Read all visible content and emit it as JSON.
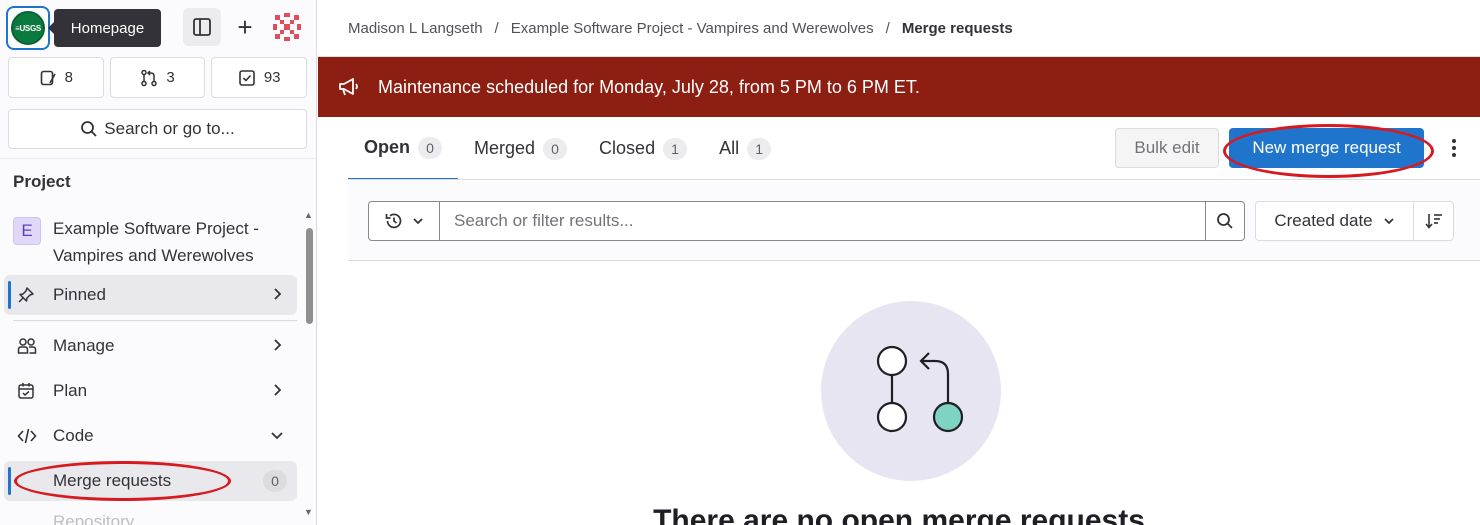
{
  "sidebar": {
    "logo_text": "≡USGS",
    "tooltip": "Homepage",
    "counters": [
      {
        "icon": "issues-icon",
        "value": "8"
      },
      {
        "icon": "merge-request-icon",
        "value": "3"
      },
      {
        "icon": "todo-icon",
        "value": "93"
      }
    ],
    "search_label": "Search or go to...",
    "section_title": "Project",
    "project": {
      "initial": "E",
      "name": "Example Software Project - Vampires and Werewolves"
    },
    "nav": {
      "pinned": "Pinned",
      "manage": "Manage",
      "plan": "Plan",
      "code": "Code",
      "merge_requests": "Merge requests",
      "merge_requests_count": "0",
      "repository": "Repository"
    }
  },
  "breadcrumb": {
    "items": [
      "Madison L Langseth",
      "Example Software Project - Vampires and Werewolves"
    ],
    "current": "Merge requests",
    "separator": "/"
  },
  "banner": {
    "text": "Maintenance scheduled for Monday, July 28, from 5 PM to 6 PM ET."
  },
  "tabs": [
    {
      "label": "Open",
      "count": "0"
    },
    {
      "label": "Merged",
      "count": "0"
    },
    {
      "label": "Closed",
      "count": "1"
    },
    {
      "label": "All",
      "count": "1"
    }
  ],
  "actions": {
    "bulk_edit": "Bulk edit",
    "new_mr": "New merge request"
  },
  "filter": {
    "placeholder": "Search or filter results...",
    "sort_label": "Created date"
  },
  "empty_state": {
    "title": "There are no open merge requests"
  },
  "colors": {
    "accent": "#1f75cb",
    "banner": "#8d1f12",
    "annotation": "#d61a1f"
  }
}
